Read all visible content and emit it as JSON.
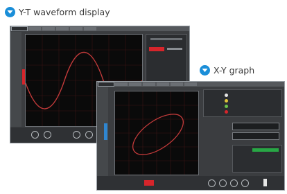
{
  "captions": {
    "yt_label": "Y-T waveform display",
    "xy_label": "X-Y graph"
  },
  "colors": {
    "badge": "#1a8ed8",
    "trace": "#c23a3a",
    "screen": "#0a0a0a",
    "chrome": "#3b3d40"
  },
  "icons": {
    "caption_badge": "chevron-down-icon"
  }
}
